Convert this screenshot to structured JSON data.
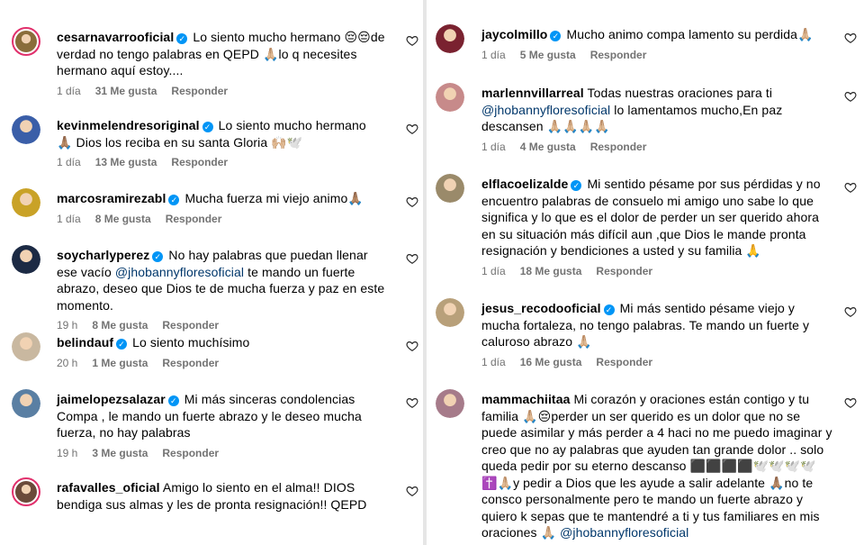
{
  "reply_label": "Responder",
  "left_comments": [
    {
      "username": "cesarnavarrooficial",
      "verified": true,
      "text": "Lo siento mucho hermano 😔😔de verdad no tengo palabras en QEPD 🙏🏼lo q necesites hermano aquí estoy....",
      "time": "1 día",
      "likes": "31 Me gusta",
      "avatar_color": "#8a6d3b",
      "ring": true
    },
    {
      "username": "kevinmelendresoriginal",
      "verified": true,
      "text": "Lo siento mucho hermano 🙏🏽 Dios los reciba en su santa Gloria 🙌🏼🕊️",
      "time": "1 día",
      "likes": "13 Me gusta",
      "avatar_color": "#3a5ea8",
      "ring": false
    },
    {
      "username": "marcosramirezabl",
      "verified": true,
      "text": "Mucha fuerza mi viejo animo🙏🏽",
      "time": "1 día",
      "likes": "8 Me gusta",
      "avatar_color": "#c9a227",
      "ring": false
    },
    {
      "username": "soycharlyperez",
      "verified": true,
      "text": "No hay palabras que puedan llenar ese vacío",
      "mention": "@jhobannyfloresoficial",
      "text_after": "te mando un fuerte abrazo, deseo que Dios te de mucha fuerza y paz en este momento.",
      "time": "19 h",
      "likes": "8 Me gusta",
      "avatar_color": "#1c2a44",
      "ring": false
    },
    {
      "username": "belindauf",
      "verified": true,
      "text": "Lo siento muchísimo",
      "time": "20 h",
      "likes": "1 Me gusta",
      "avatar_color": "#c9b8a0",
      "ring": false
    },
    {
      "username": "jaimelopezsalazar",
      "verified": true,
      "text": "Mi más sinceras condolencias Compa , le mando un fuerte abrazo y le deseo mucha fuerza, no hay palabras",
      "time": "19 h",
      "likes": "3 Me gusta",
      "avatar_color": "#5a7fa3",
      "ring": false
    },
    {
      "username": "rafavalles_oficial",
      "verified": false,
      "text": "Amigo lo siento en el alma!! DIOS bendiga sus almas y les de pronta resignación!! QEPD",
      "time": "",
      "likes": "",
      "avatar_color": "#6b4a3a",
      "ring": true
    }
  ],
  "right_comments": [
    {
      "username": "jaycolmillo",
      "verified": true,
      "text": "Mucho animo compa lamento su perdida🙏🏼",
      "time": "1 día",
      "likes": "5 Me gusta",
      "avatar_color": "#7a2230",
      "ring": false
    },
    {
      "username": "marlennvillarreal",
      "verified": false,
      "text": "Todas nuestras oraciones para ti",
      "mention": "@jhobannyfloresoficial",
      "text_after": "lo lamentamos mucho,En paz descansen 🙏🏼🙏🏼🙏🏼🙏🏼",
      "time": "1 día",
      "likes": "4 Me gusta",
      "avatar_color": "#c78a8a",
      "ring": false
    },
    {
      "username": "elflacoelizalde",
      "verified": true,
      "text": "Mi sentido pésame por sus pérdidas y no encuentro palabras de consuelo mi amigo uno sabe lo que significa y lo que es el dolor de perder un ser querido ahora en su situación más difícil aun ,que Dios le mande pronta resignación y bendiciones a usted y su familia 🙏",
      "time": "1 día",
      "likes": "18 Me gusta",
      "avatar_color": "#9a8a6a",
      "ring": false
    },
    {
      "username": "jesus_recodooficial",
      "verified": true,
      "text": "Mi más sentido pésame viejo y mucha fortaleza, no tengo palabras. Te mando un fuerte y caluroso abrazo 🙏🏼",
      "time": "1 día",
      "likes": "16 Me gusta",
      "avatar_color": "#b8a07a",
      "ring": false
    },
    {
      "username": "mammachiitaa",
      "verified": false,
      "text": "Mi corazón y oraciones están contigo y tu familia 🙏🏼😔perder un ser querido es un dolor que no se puede asimilar y más perder a 4 haci no me puedo imaginar y creo que no ay palabras que ayuden tan grande dolor .. solo queda pedir por su eterno descanso ⬛⬛⬛⬛🕊️🕊️🕊️🕊️ ✝️🙏🏼y pedir a Dios que les ayude a salir adelante 🙏🏽no te consco personalmente pero te mando un fuerte abrazo y quiero k sepas que te mantendré a ti y tus familiares en mis oraciones 🙏🏼",
      "mention_end": "@jhobannyfloresoficial",
      "time": "",
      "likes": "",
      "avatar_color": "#a67b8a",
      "ring": false
    }
  ]
}
